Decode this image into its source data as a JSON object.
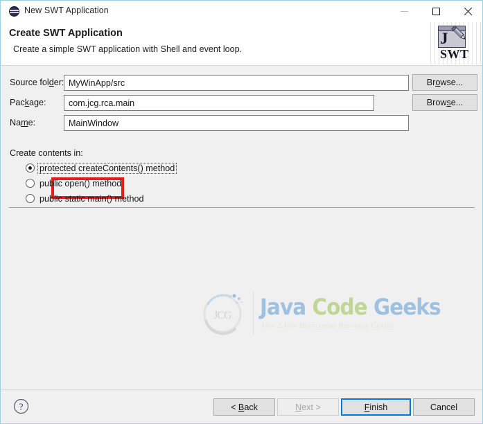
{
  "window": {
    "title": "New SWT Application",
    "icon": "swt-app-icon",
    "controls": {
      "minimize": "Minimize",
      "maximize": "Maximize",
      "close": "Close"
    }
  },
  "header": {
    "title": "Create SWT Application",
    "description": "Create a simple SWT application with Shell and event loop.",
    "logo": {
      "letter": "J",
      "caption": "SWT"
    }
  },
  "form": {
    "fields": [
      {
        "label_pre": "Source fol",
        "label_mn": "d",
        "label_post": "er:",
        "value": "MyWinApp/src",
        "placeholder": "",
        "browse_pre": "Br",
        "browse_mn": "o",
        "browse_post": "wse..."
      },
      {
        "label_pre": "Pac",
        "label_mn": "k",
        "label_post": "age:",
        "value": "com.jcg.rca.main",
        "placeholder": "",
        "browse_pre": "Brow",
        "browse_mn": "s",
        "browse_post": "e..."
      },
      {
        "label_pre": "Na",
        "label_mn": "m",
        "label_post": "e:",
        "value": "MainWindow",
        "placeholder": ""
      }
    ]
  },
  "radio_group": {
    "label": "Create contents in:",
    "options": [
      {
        "label": "protected createContents() method",
        "selected": true,
        "focused": true
      },
      {
        "label": "public open() method",
        "selected": false,
        "focused": false
      },
      {
        "label": "public static main() method",
        "selected": false,
        "focused": false
      }
    ]
  },
  "watermark": {
    "mark": "JCG",
    "word1": "Java",
    "word2": "Code",
    "word3": "Geeks",
    "tagline": "Java 2 Java Developers Resource Center"
  },
  "footer": {
    "help": "help-icon",
    "buttons": [
      {
        "pre": "< ",
        "mn": "B",
        "post": "ack",
        "disabled": false,
        "default": false
      },
      {
        "pre": "",
        "mn": "N",
        "post": "ext >",
        "disabled": true,
        "default": false
      },
      {
        "pre": "",
        "mn": "F",
        "post": "inish",
        "disabled": false,
        "default": true
      },
      {
        "pre": "",
        "mn": "",
        "post": "Cancel",
        "disabled": false,
        "default": false
      }
    ]
  },
  "colors": {
    "accent": "#0078d7",
    "annotation": "#e31d1a",
    "dialog_bg": "#f0f0f0",
    "border": "#9bd0e5"
  }
}
